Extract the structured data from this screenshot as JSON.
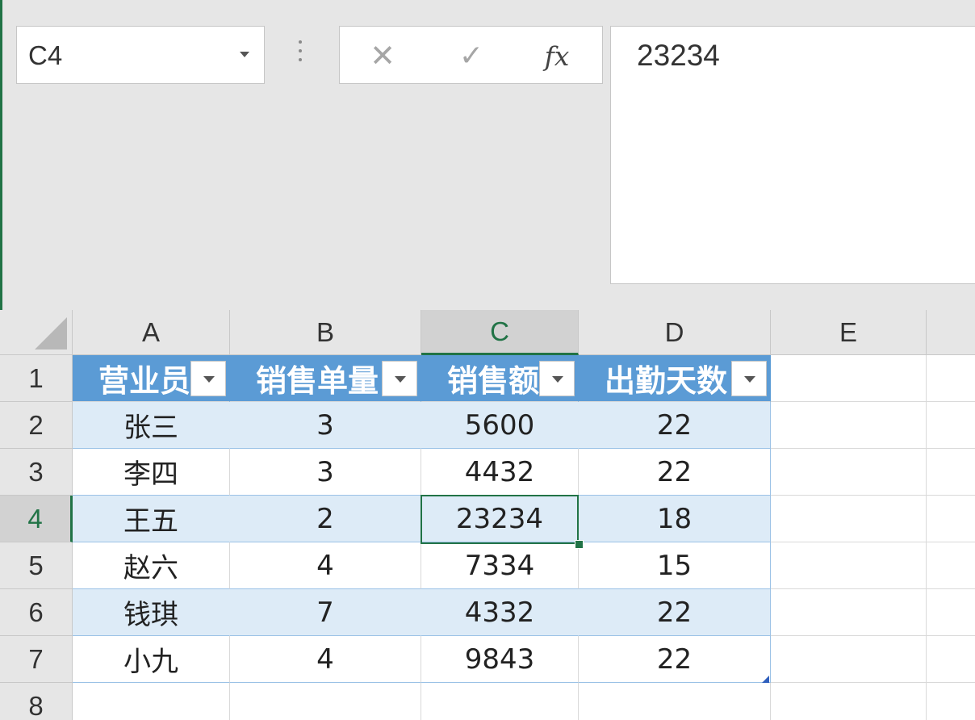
{
  "name_box": {
    "value": "C4"
  },
  "formula_bar": {
    "cancel_symbol": "✕",
    "enter_symbol": "✓",
    "fx_label": "fx",
    "value": "23234"
  },
  "columns": [
    "A",
    "B",
    "C",
    "D",
    "E"
  ],
  "rows": [
    "1",
    "2",
    "3",
    "4",
    "5",
    "6",
    "7",
    "8"
  ],
  "table": {
    "headers": [
      "营业员",
      "销售单量",
      "销售额",
      "出勤天数"
    ],
    "data": [
      [
        "张三",
        "3",
        "5600",
        "22"
      ],
      [
        "李四",
        "3",
        "4432",
        "22"
      ],
      [
        "王五",
        "2",
        "23234",
        "18"
      ],
      [
        "赵六",
        "4",
        "7334",
        "15"
      ],
      [
        "钱琪",
        "7",
        "4332",
        "22"
      ],
      [
        "小九",
        "4",
        "9843",
        "22"
      ]
    ]
  },
  "selection": {
    "active_cell": "C4"
  },
  "colors": {
    "accent": "#217346",
    "table_header": "#5b9bd5",
    "table_band": "#ddebf7"
  }
}
